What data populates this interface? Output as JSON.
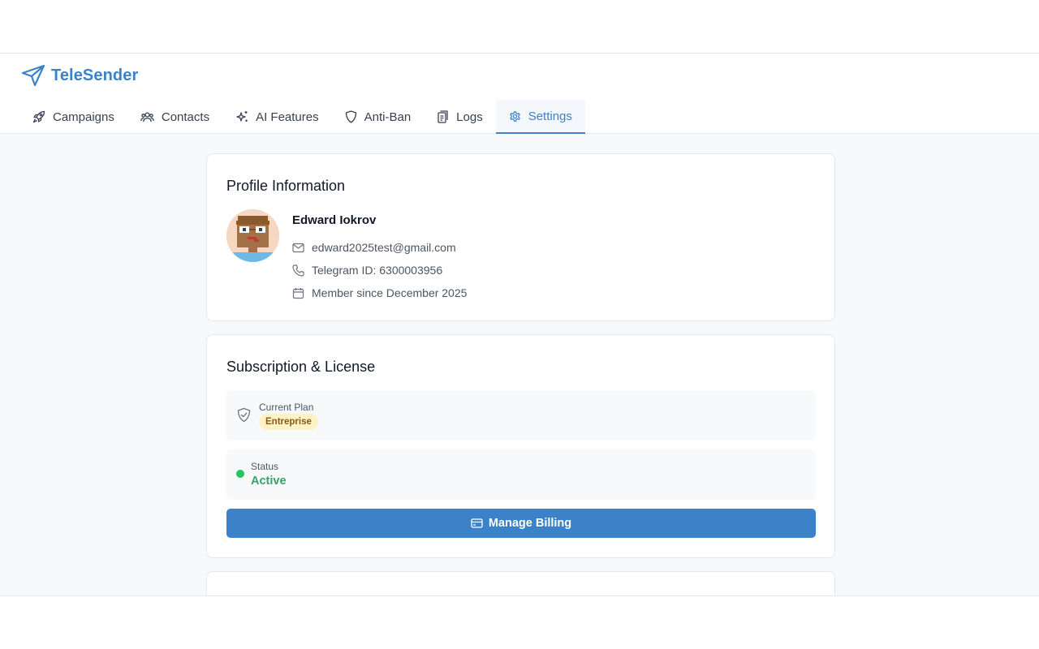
{
  "app": {
    "name": "TeleSender",
    "brand_color": "#3b82c8"
  },
  "tabs": [
    {
      "label": "Campaigns",
      "icon": "rocket-icon"
    },
    {
      "label": "Contacts",
      "icon": "users-icon"
    },
    {
      "label": "AI Features",
      "icon": "sparkles-icon"
    },
    {
      "label": "Anti-Ban",
      "icon": "shield-icon"
    },
    {
      "label": "Logs",
      "icon": "clipboard-icon"
    },
    {
      "label": "Settings",
      "icon": "gear-icon",
      "active": true
    }
  ],
  "profile": {
    "title": "Profile Information",
    "name": "Edward Iokrov",
    "email": "edward2025test@gmail.com",
    "telegram": "Telegram ID: 6300003956",
    "member_since": "Member since December 2025"
  },
  "subscription": {
    "title": "Subscription & License",
    "plan_label": "Current Plan",
    "plan_value": "Entreprise",
    "status_label": "Status",
    "status_value": "Active",
    "status_color": "#22c55e",
    "billing_button": "Manage Billing"
  }
}
